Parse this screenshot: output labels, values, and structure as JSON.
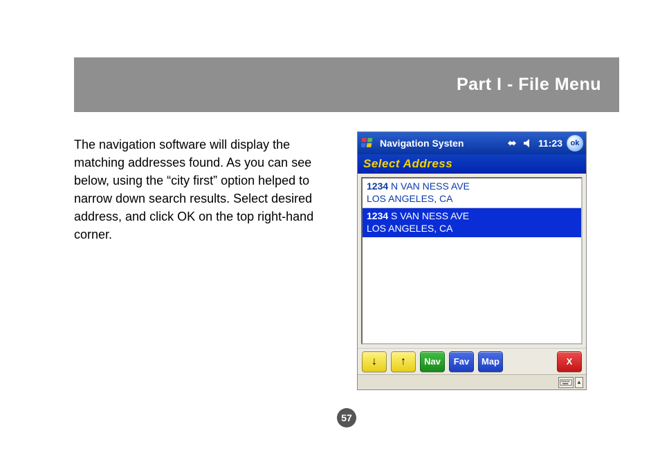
{
  "header": {
    "title": "Part I - File Menu"
  },
  "body_text": "The navigation software will display the matching addresses found.  As you can see below, using the “city first” option helped to narrow down search results.  Select desired address, and click OK on the top right-hand corner.",
  "page_number": "57",
  "device": {
    "titlebar": {
      "start_icon": "windows-flag-icon",
      "app_title": "Navigation Systen",
      "conn_icon": "connectivity-icon",
      "vol_icon": "volume-icon",
      "clock": "11:23",
      "ok_label": "ok"
    },
    "subheader": "Select Address",
    "list_items": [
      {
        "house_number": "1234",
        "street": " N VAN NESS AVE",
        "city": "LOS ANGELES, CA",
        "selected": false
      },
      {
        "house_number": "1234",
        "street": " S VAN NESS AVE",
        "city": "LOS ANGELES, CA",
        "selected": true
      }
    ],
    "toolbar": {
      "down_arrow": "↓",
      "up_arrow": "↑",
      "nav_label": "Nav",
      "fav_label": "Fav",
      "map_label": "Map",
      "close_label": "X"
    },
    "sysbar": {
      "keyboard_icon": "keyboard-icon",
      "expand_arrow": "▴"
    }
  }
}
